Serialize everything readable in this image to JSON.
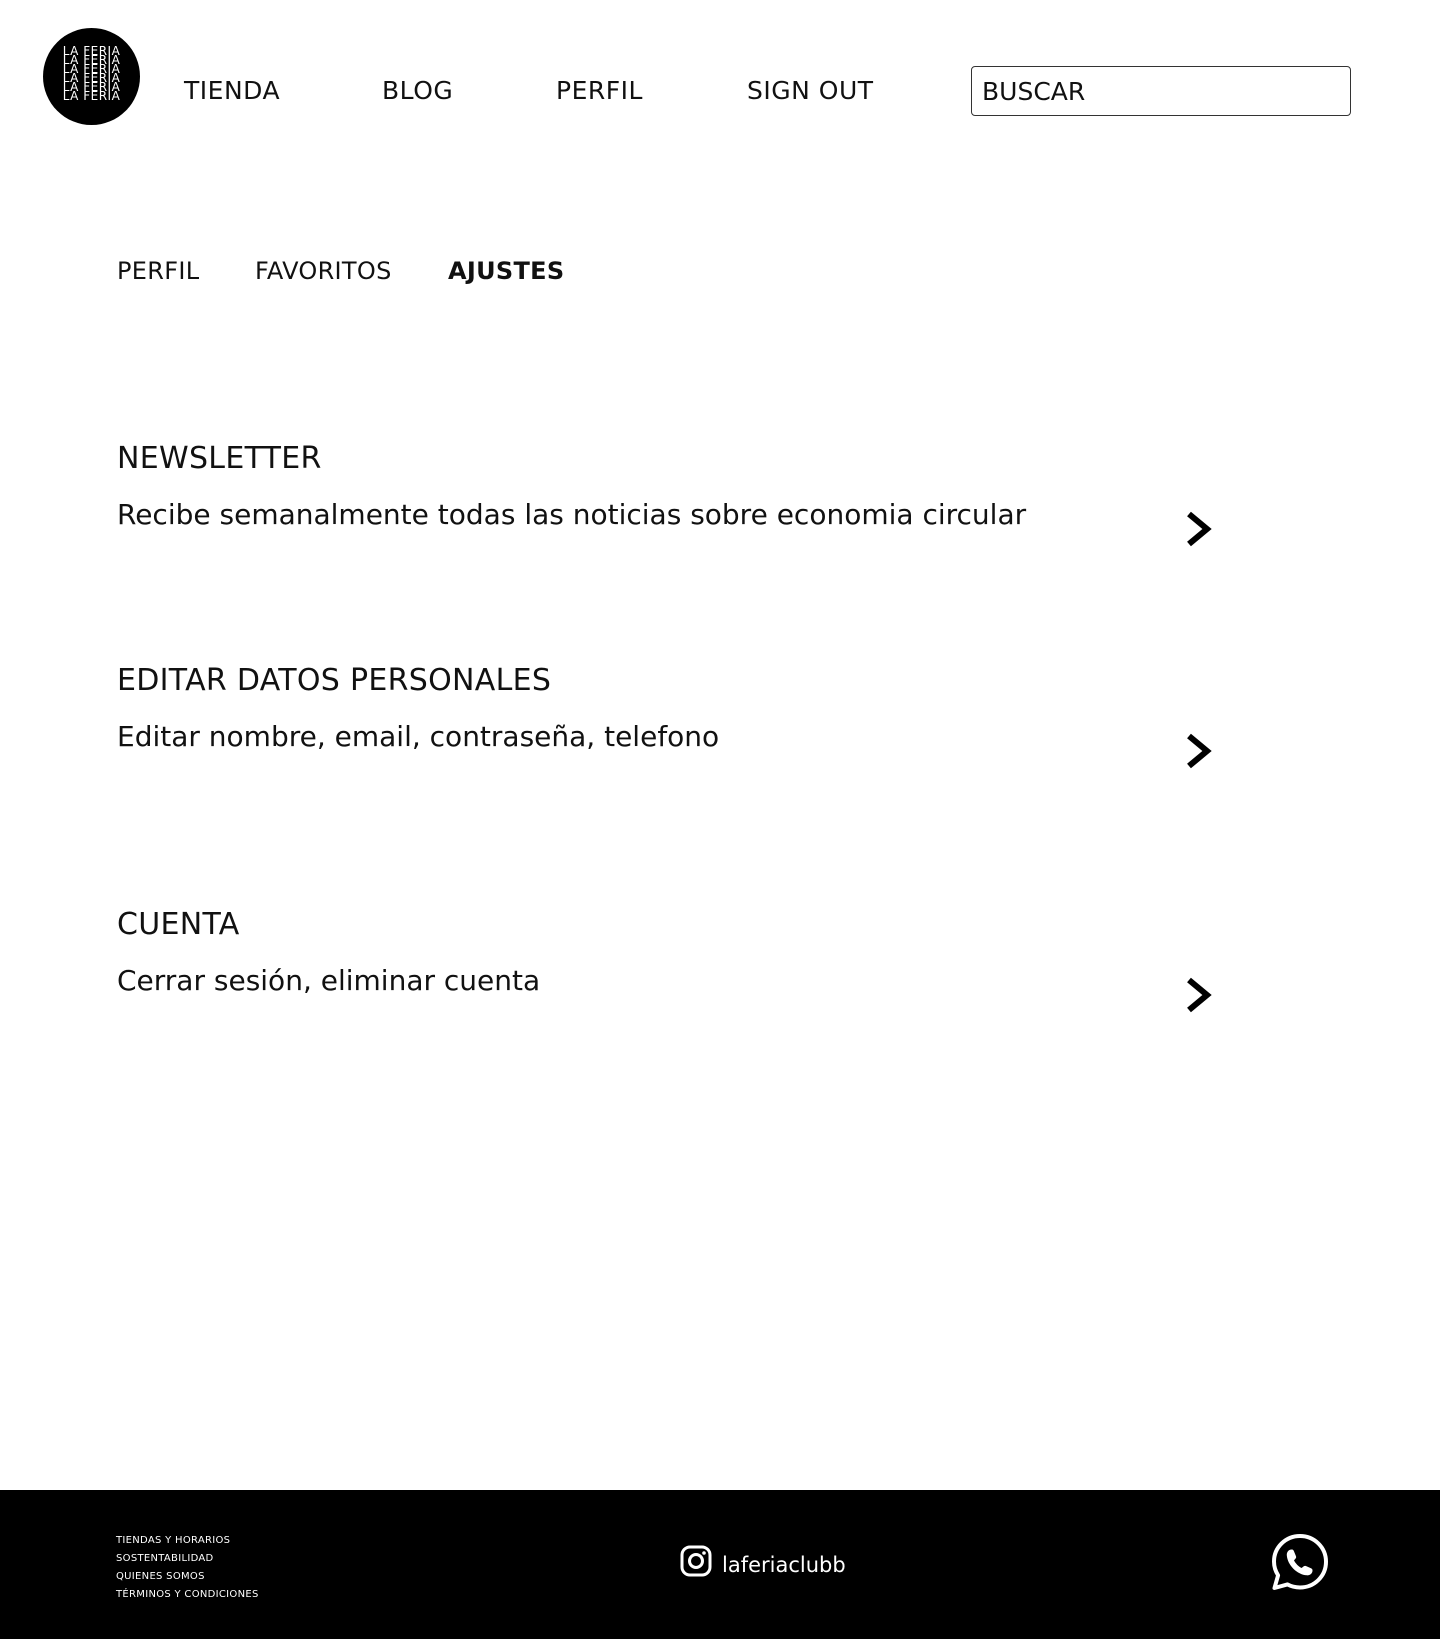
{
  "header": {
    "logo_text": "LA FERIA",
    "nav": {
      "tienda": "TIENDA",
      "blog": "BLOG",
      "perfil": "PERFIL",
      "sign_out": "SIGN OUT"
    },
    "search": {
      "placeholder": "BUSCAR"
    }
  },
  "tabs": {
    "perfil": "PERFIL",
    "favoritos": "FAVORITOS",
    "ajustes": "AJUSTES",
    "active": "AJUSTES"
  },
  "sections": [
    {
      "title": "NEWSLETTER",
      "description": "Recibe semanalmente todas las noticias sobre economia circular"
    },
    {
      "title": "EDITAR DATOS PERSONALES",
      "description": "Editar nombre, email, contraseña, telefono"
    },
    {
      "title": "CUENTA",
      "description": "Cerrar sesión, eliminar cuenta"
    }
  ],
  "footer": {
    "links": [
      "TIENDAS Y HORARIOS",
      "SOSTENTABILIDAD",
      "QUIENES SOMOS",
      "TÉRMINOS Y CONDICIONES"
    ],
    "instagram_handle": "laferiaclubb",
    "icons": [
      "instagram-icon",
      "whatsapp-icon"
    ]
  },
  "colors": {
    "background": "#ffffff",
    "text": "#111111",
    "footer_background": "#000000",
    "footer_text": "#ffffff"
  }
}
